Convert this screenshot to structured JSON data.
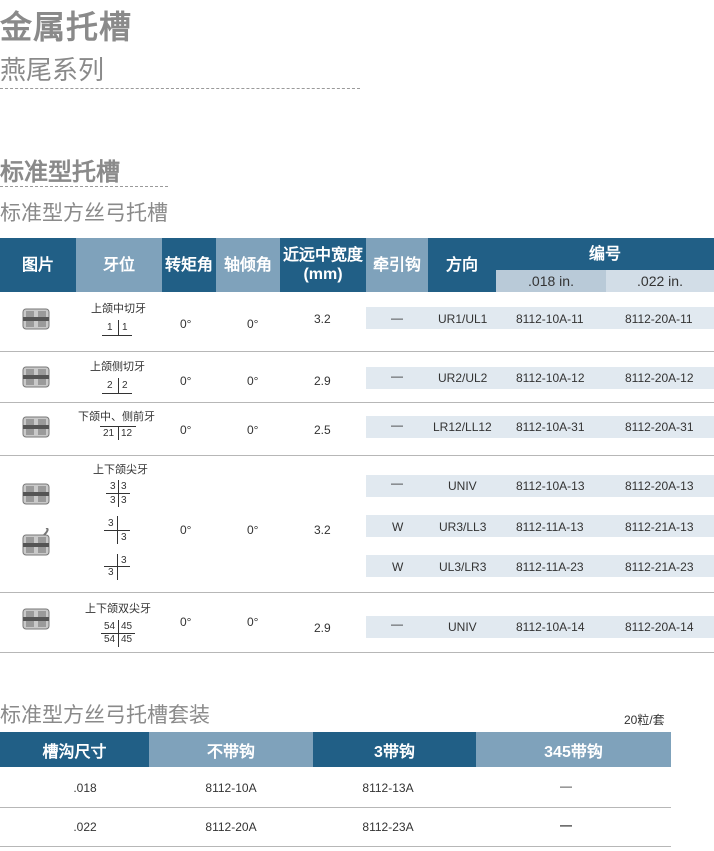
{
  "title": "金属托槽",
  "subtitle": "燕尾系列",
  "section1": {
    "title": "标准型托槽",
    "subtitle": "标准型方丝弓托槽"
  },
  "table_headers": {
    "image": "图片",
    "tooth": "牙位",
    "torque": "转矩角",
    "angulation": "轴倾角",
    "width_line1": "近远中宽度",
    "width_line2": "(mm)",
    "hook": "牵引钩",
    "direction": "方向",
    "code": "编号",
    "code018": ".018 in.",
    "code022": ".022 in."
  },
  "rows": [
    {
      "tooth_label": "上颌中切牙",
      "q_ul": "1",
      "q_ur": "1",
      "torque": "0°",
      "angulation": "0°",
      "width": "3.2",
      "hook": "—",
      "direction": "UR1/UL1",
      "code018": "8112-10A-11",
      "code022": "8112-20A-11"
    },
    {
      "tooth_label": "上颌侧切牙",
      "q_ul": "2",
      "q_ur": "2",
      "torque": "0°",
      "angulation": "0°",
      "width": "2.9",
      "hook": "—",
      "direction": "UR2/UL2",
      "code018": "8112-10A-12",
      "code022": "8112-20A-12"
    },
    {
      "tooth_label": "下颌中、侧前牙",
      "q_ll": "21",
      "q_lr": "12",
      "torque": "0°",
      "angulation": "0°",
      "width": "2.5",
      "hook": "—",
      "direction": "LR12/LL12",
      "code018": "8112-10A-31",
      "code022": "8112-20A-31"
    },
    {
      "tooth_label": "上下颌尖牙",
      "torque": "0°",
      "angulation": "0°",
      "width": "3.2",
      "sub": [
        {
          "q1": "3",
          "q2": "3",
          "q3": "3",
          "q4": "3",
          "hook": "—",
          "direction": "UNIV",
          "code018": "8112-10A-13",
          "code022": "8112-20A-13"
        },
        {
          "q1": "3",
          "q2": "3",
          "hook": "W",
          "direction": "UR3/LL3",
          "code018": "8112-11A-13",
          "code022": "8112-21A-13"
        },
        {
          "q1": "3",
          "q2": "3",
          "hook": "W",
          "direction": "UL3/LR3",
          "code018": "8112-11A-23",
          "code022": "8112-21A-23"
        }
      ]
    },
    {
      "tooth_label": "上下颌双尖牙",
      "q_ul": "54",
      "q_ur": "45",
      "q_ll": "54",
      "q_lr": "45",
      "torque": "0°",
      "angulation": "0°",
      "width": "2.9",
      "hook": "—",
      "direction": "UNIV",
      "code018": "8112-10A-14",
      "code022": "8112-20A-14"
    }
  ],
  "kit": {
    "title": "标准型方丝弓托槽套装",
    "unit": "20粒/套",
    "headers": [
      "槽沟尺寸",
      "不带钩",
      "3带钩",
      "345带钩"
    ],
    "rows": [
      [
        ".018",
        "8112-10A",
        "8112-13A",
        "—"
      ],
      [
        ".022",
        "8112-20A",
        "8112-23A",
        "—"
      ]
    ]
  },
  "colors": {
    "header_dark": "#215f86",
    "header_light": "#7fa2bb",
    "band": "#e1e9f0",
    "title_gray": "#8a8a8a"
  }
}
